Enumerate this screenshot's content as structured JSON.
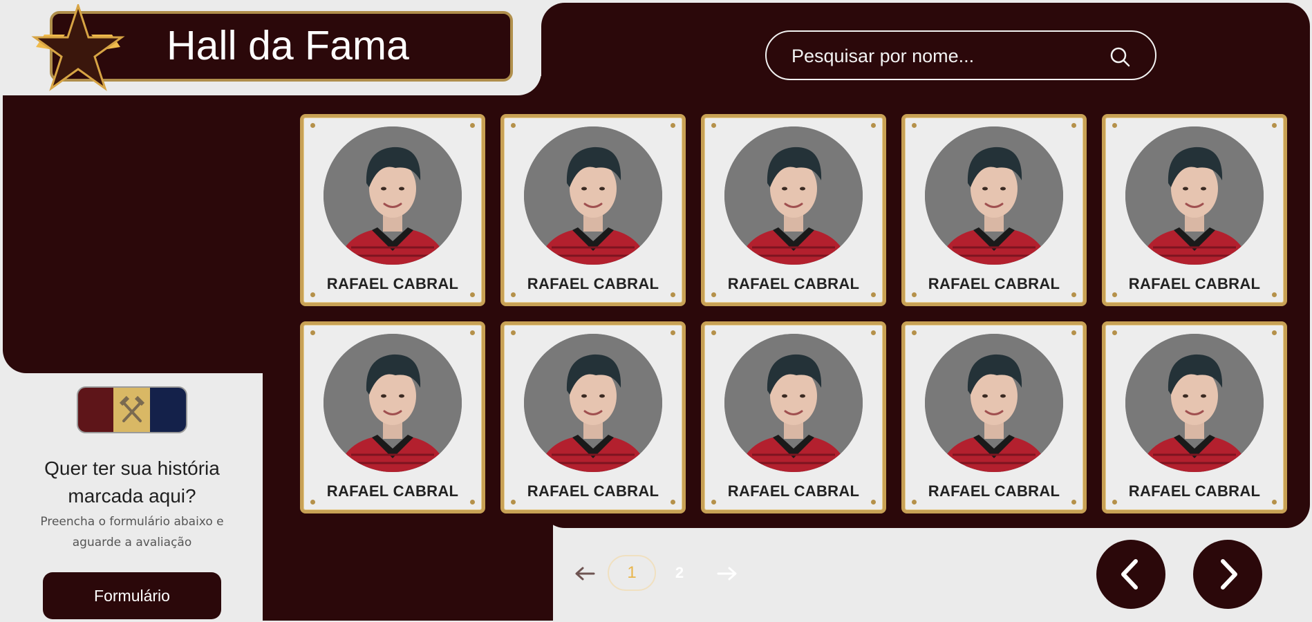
{
  "header": {
    "title": "Hall da Fama"
  },
  "search": {
    "placeholder": "Pesquisar por nome..."
  },
  "cards": [
    {
      "name": "RAFAEL CABRAL"
    },
    {
      "name": "RAFAEL CABRAL"
    },
    {
      "name": "RAFAEL CABRAL"
    },
    {
      "name": "RAFAEL CABRAL"
    },
    {
      "name": "RAFAEL CABRAL"
    },
    {
      "name": "RAFAEL CABRAL"
    },
    {
      "name": "RAFAEL CABRAL"
    },
    {
      "name": "RAFAEL CABRAL"
    },
    {
      "name": "RAFAEL CABRAL"
    },
    {
      "name": "RAFAEL CABRAL"
    }
  ],
  "cta": {
    "heading": "Quer ter sua história marcada aqui?",
    "subtext": "Preencha o formulário abaixo e aguarde a avaliação",
    "button_label": "Formulário"
  },
  "pagination": {
    "pages": [
      "1",
      "2"
    ],
    "current": "1"
  },
  "icons": {
    "logo": "star-icon",
    "search": "search-icon",
    "crest": "crest-icon",
    "prev_page": "arrow-left-icon",
    "next_page": "arrow-right-icon",
    "carousel_prev": "chevron-left-icon",
    "carousel_next": "chevron-right-icon"
  },
  "colors": {
    "background": "#ebebeb",
    "panel": "#2b080a",
    "gold": "#c8a155",
    "accent": "#e8b54b",
    "card": "#ededed"
  }
}
